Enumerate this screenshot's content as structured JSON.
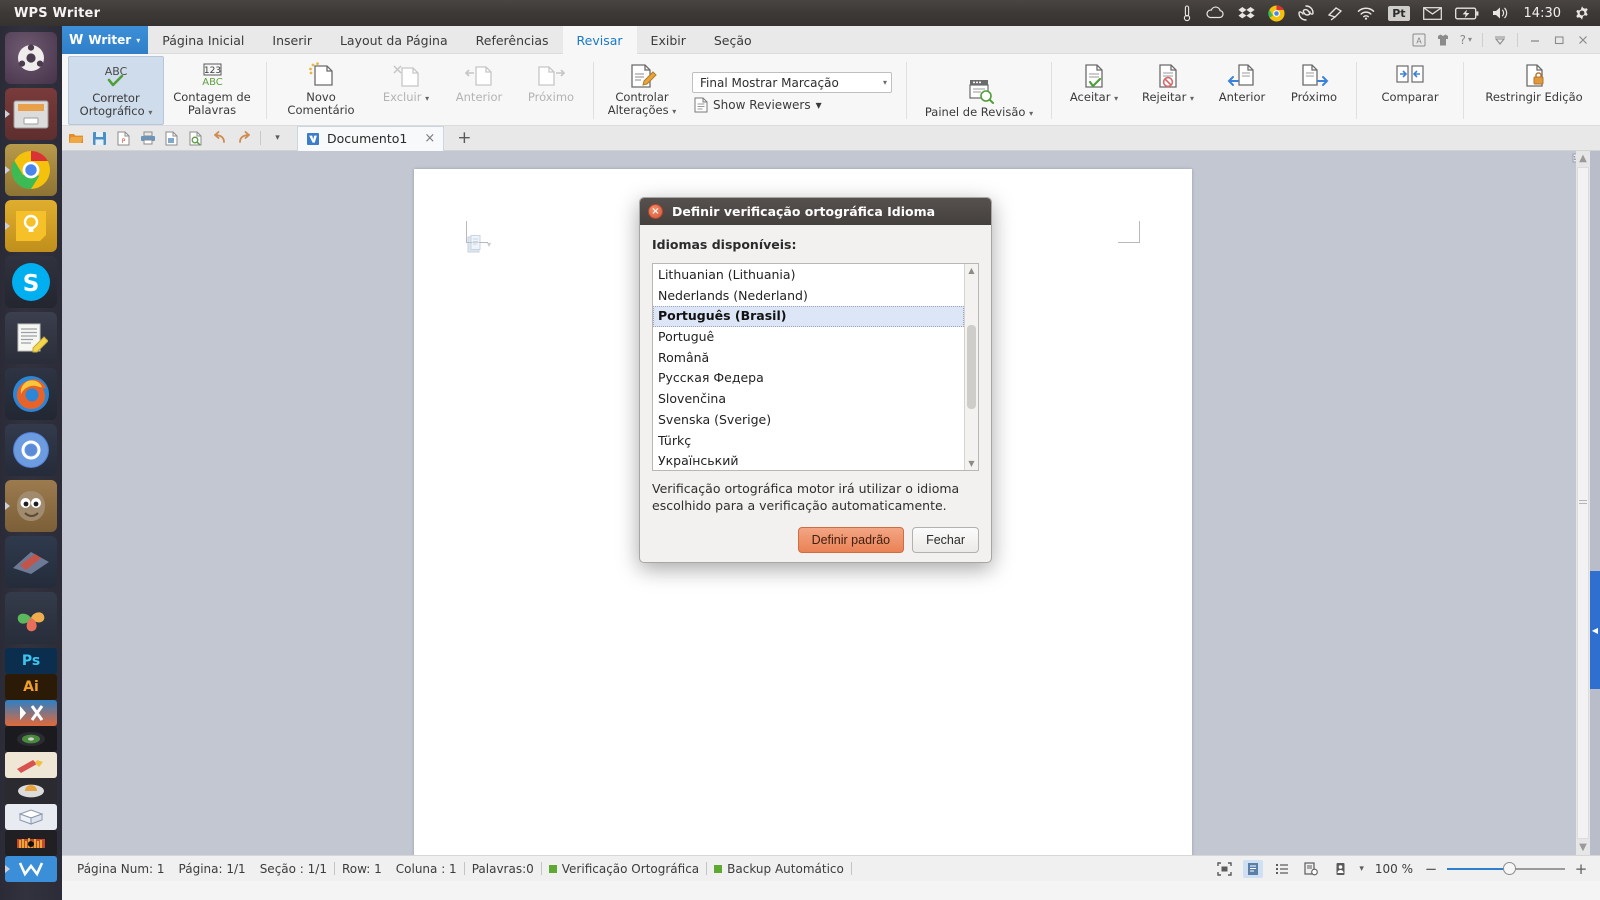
{
  "desktop": {
    "panel": {
      "app_title": "WPS Writer",
      "clock": "14:30",
      "tray_icons": [
        "thermometer-icon",
        "cloud-icon",
        "dropbox-icon",
        "chrome-icon",
        "shutter-icon",
        "kite-icon",
        "wifi-icon",
        "keyboard-layout-pt",
        "mail-icon",
        "battery-icon",
        "volume-icon"
      ],
      "keyboard_layout": "Pt"
    },
    "launcher": {
      "items": [
        {
          "name": "ubuntu-dash-icon",
          "label": "Dash"
        },
        {
          "name": "files-icon",
          "label": "Arquivos",
          "running": true
        },
        {
          "name": "chrome-icon",
          "label": "Google Chrome",
          "running": true
        },
        {
          "name": "keep-icon",
          "label": "Notas",
          "running": true
        },
        {
          "name": "skype-icon",
          "label": "Skype"
        },
        {
          "name": "text-editor-icon",
          "label": "Editor de Texto"
        },
        {
          "name": "firefox-icon",
          "label": "Firefox"
        },
        {
          "name": "chromium-icon",
          "label": "Chromium"
        },
        {
          "name": "gimp-icon",
          "label": "GIMP",
          "running": true
        },
        {
          "name": "gradient-icon",
          "label": "Gradiente"
        },
        {
          "name": "pinwheel-icon",
          "label": "Pinwheel"
        },
        {
          "name": "photoshop-icon",
          "label": "Ps"
        },
        {
          "name": "illustrator-icon",
          "label": "Ai"
        },
        {
          "name": "kx-icon",
          "label": "KX"
        },
        {
          "name": "disc-icon",
          "label": "Disco"
        },
        {
          "name": "paint-icon",
          "label": "Paint"
        },
        {
          "name": "media-icon",
          "label": "Mídia"
        },
        {
          "name": "box-icon",
          "label": "Caixa"
        },
        {
          "name": "audio-icon",
          "label": "Áudio"
        },
        {
          "name": "wps-icon",
          "label": "WPS",
          "running": true
        }
      ]
    }
  },
  "window": {
    "title": "WPS Writer",
    "controls": [
      "doc-mode-icon",
      "skin-icon",
      "help-icon",
      "collapse-ribbon-icon",
      "minimize-icon",
      "maximize-icon",
      "close-icon"
    ],
    "help_label": "?"
  },
  "ribbon": {
    "app_button": {
      "label": "Writer",
      "glyph": "W"
    },
    "tabs": [
      {
        "label": "Página Inicial",
        "active": false
      },
      {
        "label": "Inserir",
        "active": false
      },
      {
        "label": "Layout da Página",
        "active": false
      },
      {
        "label": "Referências",
        "active": false
      },
      {
        "label": "Revisar",
        "active": true
      },
      {
        "label": "Exibir",
        "active": false
      },
      {
        "label": "Seção",
        "active": false
      }
    ],
    "groups": {
      "proofing": [
        {
          "name": "spell-check",
          "label_line1": "Corretor",
          "label_line2": "Ortográfico",
          "icon": "abc-check-icon",
          "selected": true,
          "dropdown": true,
          "disabled": false
        },
        {
          "name": "word-count",
          "label_line1": "Contagem de",
          "label_line2": "Palavras",
          "icon": "123-abc-icon",
          "selected": false,
          "dropdown": false,
          "disabled": false
        }
      ],
      "comments": [
        {
          "name": "new-comment",
          "label_line1": "Novo",
          "label_line2": "Comentário",
          "icon": "new-comment-icon",
          "selected": false,
          "dropdown": false,
          "disabled": false
        },
        {
          "name": "delete-comment",
          "label_line1": "Excluir",
          "label_line2": "",
          "icon": "delete-comment-icon",
          "selected": false,
          "dropdown": true,
          "disabled": true
        },
        {
          "name": "previous-comment",
          "label_line1": "Anterior",
          "label_line2": "",
          "icon": "prev-comment-icon",
          "selected": false,
          "dropdown": false,
          "disabled": true
        },
        {
          "name": "next-comment",
          "label_line1": "Próximo",
          "label_line2": "",
          "icon": "next-comment-icon",
          "selected": false,
          "dropdown": false,
          "disabled": true
        }
      ],
      "tracking": {
        "track_changes": {
          "name": "track-changes",
          "label_line1": "Controlar",
          "label_line2": "Alterações",
          "icon": "track-changes-icon",
          "dropdown": true
        },
        "display_combo": {
          "value": "Final Mostrar Marcação"
        },
        "show_reviewers": {
          "label": "Show Reviewers",
          "icon": "show-reviewers-icon",
          "dropdown": true
        },
        "review_pane": {
          "label": "Painel de Revisão",
          "icon": "review-pane-icon",
          "dropdown": true
        }
      },
      "changes": [
        {
          "name": "accept-change",
          "label_line1": "Aceitar",
          "label_line2": "",
          "icon": "accept-icon",
          "dropdown": true,
          "disabled": false
        },
        {
          "name": "reject-change",
          "label_line1": "Rejeitar",
          "label_line2": "",
          "icon": "reject-icon",
          "dropdown": true,
          "disabled": false
        },
        {
          "name": "previous-change",
          "label_line1": "Anterior",
          "label_line2": "",
          "icon": "prev-change-icon",
          "dropdown": false,
          "disabled": false
        },
        {
          "name": "next-change",
          "label_line1": "Próximo",
          "label_line2": "",
          "icon": "next-change-icon",
          "dropdown": false,
          "disabled": false
        }
      ],
      "compare": [
        {
          "name": "compare",
          "label_line1": "Comparar",
          "label_line2": "",
          "icon": "compare-icon",
          "dropdown": false,
          "disabled": false
        }
      ],
      "protect": [
        {
          "name": "restrict-editing",
          "label_line1": "Restringir Edição",
          "label_line2": "",
          "icon": "restrict-edit-icon",
          "dropdown": false,
          "disabled": false
        }
      ]
    }
  },
  "doc_tabs": {
    "quick_access": [
      "open-icon",
      "save-icon",
      "export-pdf-icon",
      "print-icon",
      "print-preview-icon",
      "find-icon",
      "undo-icon",
      "redo-icon",
      "customize-caret-icon"
    ],
    "tabs": [
      {
        "label": "Documento1",
        "icon": "doc-icon",
        "active": true
      }
    ],
    "new_tab_label": "+"
  },
  "dialog": {
    "title": "Definir verificação ortográfica Idioma",
    "close_glyph": "×",
    "list_label": "Idiomas disponíveis:",
    "languages": [
      {
        "label": "Lithuanian (Lithuania)",
        "selected": false
      },
      {
        "label": "Nederlands (Nederland)",
        "selected": false
      },
      {
        "label": "Português (Brasil)",
        "selected": true
      },
      {
        "label": "Portuguê",
        "selected": false
      },
      {
        "label": "Română",
        "selected": false
      },
      {
        "label": "Русская Федера",
        "selected": false
      },
      {
        "label": "Slovenčina",
        "selected": false
      },
      {
        "label": "Svenska (Sverige)",
        "selected": false
      },
      {
        "label": "Türkç",
        "selected": false
      },
      {
        "label": "Український",
        "selected": false
      }
    ],
    "note_line1": "Verificação ortográfica motor irá utilizar o idioma",
    "note_line2": "escolhido para a verificação automaticamente.",
    "buttons": {
      "primary": "Definir padrão",
      "secondary": "Fechar"
    },
    "accent_color": "#ea8255"
  },
  "statusbar": {
    "page_num": "Página Num: 1",
    "pages": "Página: 1/1",
    "section": "Seção : 1/1",
    "row": "Row: 1",
    "column": "Coluna : 1",
    "words": "Palavras:0",
    "spellcheck": "Verificação Ortográfica",
    "autobackup": "Backup Automático",
    "indicator_color": "#5fa832",
    "view_buttons": [
      "full-screen-view-icon",
      "print-layout-view-icon",
      "outline-view-icon",
      "web-layout-view-icon",
      "reading-layout-icon"
    ],
    "view_dropdown_caret": "▾",
    "zoom_level": "100 %",
    "zoom_out_glyph": "−",
    "zoom_in_glyph": "+"
  }
}
